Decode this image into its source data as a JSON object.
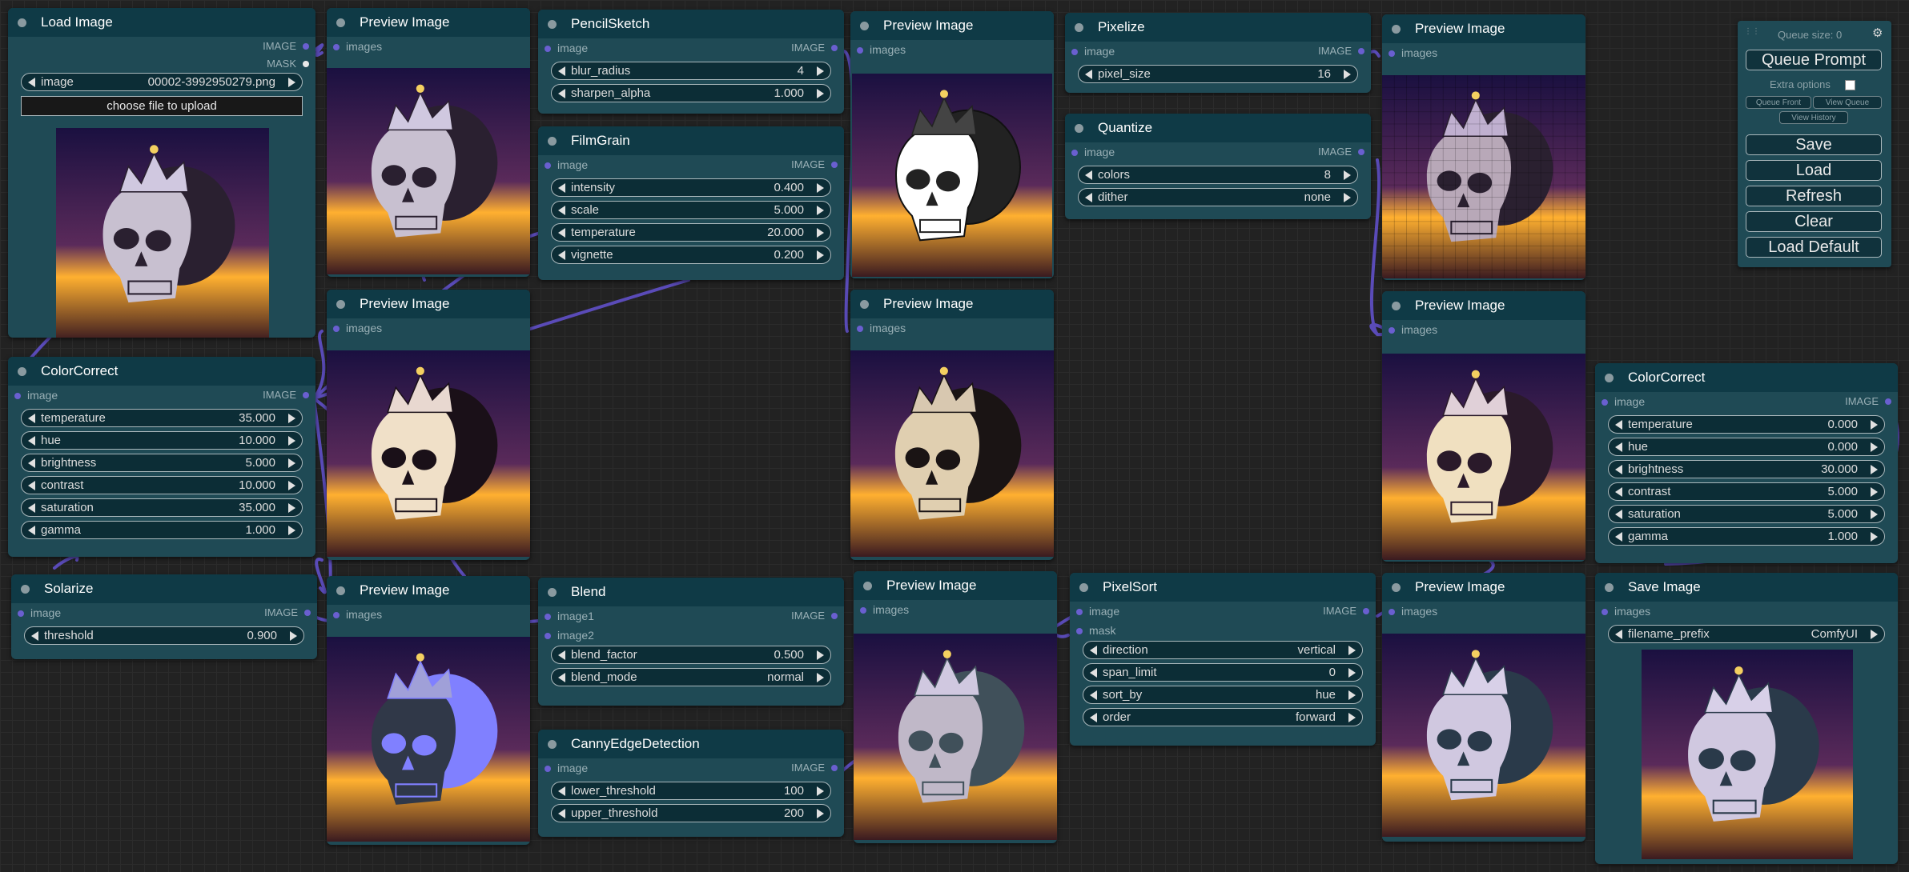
{
  "queue": {
    "size_label": "Queue size: 0",
    "queue_prompt": "Queue Prompt",
    "extra_options": "Extra options",
    "queue_front": "Queue Front",
    "view_queue": "View Queue",
    "view_history": "View History",
    "save": "Save",
    "load": "Load",
    "refresh": "Refresh",
    "clear": "Clear",
    "load_default": "Load Default"
  },
  "nodes": {
    "load_image": {
      "title": "Load Image",
      "out_image": "IMAGE",
      "out_mask": "MASK",
      "image_name": "image",
      "image_value": "00002-3992950279.png",
      "upload": "choose file to upload"
    },
    "preview1": {
      "title": "Preview Image",
      "in": "images"
    },
    "preview2": {
      "title": "Preview Image",
      "in": "images"
    },
    "preview3": {
      "title": "Preview Image",
      "in": "images"
    },
    "preview4": {
      "title": "Preview Image",
      "in": "images"
    },
    "preview5": {
      "title": "Preview Image",
      "in": "images"
    },
    "preview6": {
      "title": "Preview Image",
      "in": "images"
    },
    "preview7": {
      "title": "Preview Image",
      "in": "images"
    },
    "preview8": {
      "title": "Preview Image",
      "in": "images"
    },
    "pencil": {
      "title": "PencilSketch",
      "in": "image",
      "out": "IMAGE",
      "widgets": [
        {
          "name": "blur_radius",
          "value": "4"
        },
        {
          "name": "sharpen_alpha",
          "value": "1.000"
        }
      ]
    },
    "film": {
      "title": "FilmGrain",
      "in": "image",
      "out": "IMAGE",
      "widgets": [
        {
          "name": "intensity",
          "value": "0.400"
        },
        {
          "name": "scale",
          "value": "5.000"
        },
        {
          "name": "temperature",
          "value": "20.000"
        },
        {
          "name": "vignette",
          "value": "0.200"
        }
      ]
    },
    "pixelize": {
      "title": "Pixelize",
      "in": "image",
      "out": "IMAGE",
      "widgets": [
        {
          "name": "pixel_size",
          "value": "16"
        }
      ]
    },
    "quantize": {
      "title": "Quantize",
      "in": "image",
      "out": "IMAGE",
      "widgets": [
        {
          "name": "colors",
          "value": "8"
        },
        {
          "name": "dither",
          "value": "none"
        }
      ]
    },
    "cc1": {
      "title": "ColorCorrect",
      "in": "image",
      "out": "IMAGE",
      "widgets": [
        {
          "name": "temperature",
          "value": "35.000"
        },
        {
          "name": "hue",
          "value": "10.000"
        },
        {
          "name": "brightness",
          "value": "5.000"
        },
        {
          "name": "contrast",
          "value": "10.000"
        },
        {
          "name": "saturation",
          "value": "35.000"
        },
        {
          "name": "gamma",
          "value": "1.000"
        }
      ]
    },
    "cc2": {
      "title": "ColorCorrect",
      "in": "image",
      "out": "IMAGE",
      "widgets": [
        {
          "name": "temperature",
          "value": "0.000"
        },
        {
          "name": "hue",
          "value": "0.000"
        },
        {
          "name": "brightness",
          "value": "30.000"
        },
        {
          "name": "contrast",
          "value": "5.000"
        },
        {
          "name": "saturation",
          "value": "5.000"
        },
        {
          "name": "gamma",
          "value": "1.000"
        }
      ]
    },
    "solarize": {
      "title": "Solarize",
      "in": "image",
      "out": "IMAGE",
      "widgets": [
        {
          "name": "threshold",
          "value": "0.900"
        }
      ]
    },
    "blend": {
      "title": "Blend",
      "in1": "image1",
      "in2": "image2",
      "out": "IMAGE",
      "widgets": [
        {
          "name": "blend_factor",
          "value": "0.500"
        },
        {
          "name": "blend_mode",
          "value": "normal"
        }
      ]
    },
    "canny": {
      "title": "CannyEdgeDetection",
      "in": "image",
      "out": "IMAGE",
      "widgets": [
        {
          "name": "lower_threshold",
          "value": "100"
        },
        {
          "name": "upper_threshold",
          "value": "200"
        }
      ]
    },
    "pixelsort": {
      "title": "PixelSort",
      "in": "image",
      "in2": "mask",
      "out": "IMAGE",
      "widgets": [
        {
          "name": "direction",
          "value": "vertical"
        },
        {
          "name": "span_limit",
          "value": "0"
        },
        {
          "name": "sort_by",
          "value": "hue"
        },
        {
          "name": "order",
          "value": "forward"
        }
      ]
    },
    "save": {
      "title": "Save Image",
      "in": "images",
      "widgets": [
        {
          "name": "filename_prefix",
          "value": "ComfyUI"
        }
      ]
    }
  },
  "colors": {
    "node_body": "#1f4a55",
    "node_title": "#0f3a46",
    "wire": "#5a4bb8",
    "canvas": "#222222"
  }
}
